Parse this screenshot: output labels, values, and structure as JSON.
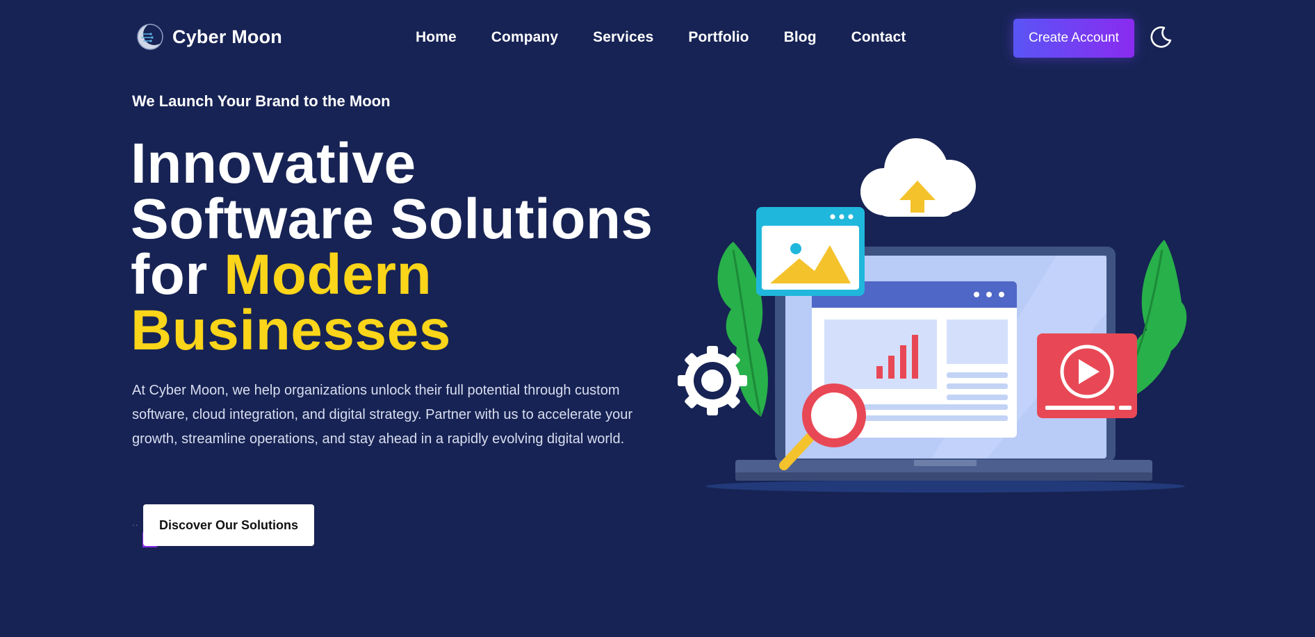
{
  "brand": {
    "name": "Cyber Moon",
    "logo_icon": "moon-circuit-logo"
  },
  "nav": {
    "items": [
      {
        "label": "Home"
      },
      {
        "label": "Company"
      },
      {
        "label": "Services"
      },
      {
        "label": "Portfolio"
      },
      {
        "label": "Blog"
      },
      {
        "label": "Contact"
      }
    ]
  },
  "header": {
    "cta_label": "Create Account",
    "theme_toggle_icon": "moon-icon"
  },
  "hero": {
    "eyebrow": "We Launch Your Brand to the Moon",
    "headline": {
      "line1": "Innovative",
      "line2": "Software Solutions",
      "line3_plain": "for ",
      "line3_accent": "Modern",
      "line4_accent": "Businesses"
    },
    "description": "At Cyber Moon, we help organizations unlock their full potential through custom software, cloud integration, and digital strategy. Partner with us to accelerate your growth, streamline operations, and stay ahead in a rapidly evolving digital world.",
    "button_label": "Discover Our Solutions",
    "button_prefix": ".."
  },
  "colors": {
    "background": "#172354",
    "accent_yellow": "#fad519",
    "cta_gradient_start": "#5a55f5",
    "cta_gradient_end": "#8a2bf0",
    "text": "#ffffff"
  },
  "illustration": {
    "icons": [
      "cloud-upload-icon",
      "image-window-icon",
      "gear-icon",
      "laptop-dashboard-icon",
      "magnifier-icon",
      "video-play-icon",
      "leaf-icon"
    ]
  }
}
